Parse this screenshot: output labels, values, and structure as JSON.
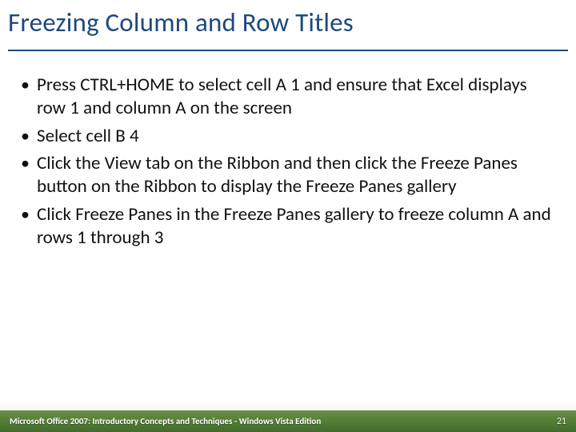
{
  "title": "Freezing Column and Row Titles",
  "bullets": [
    "Press CTRL+HOME to select cell A 1 and ensure that Excel displays row 1 and column A on the screen",
    "Select cell B 4",
    "Click the View tab on the Ribbon and then click the Freeze Panes button on the Ribbon to display the Freeze Panes gallery",
    "Click Freeze Panes in the Freeze Panes gallery to freeze column A and rows 1 through 3"
  ],
  "footer": {
    "text": "Microsoft Office 2007: Introductory Concepts and Techniques - Windows Vista Edition",
    "page": "21"
  }
}
